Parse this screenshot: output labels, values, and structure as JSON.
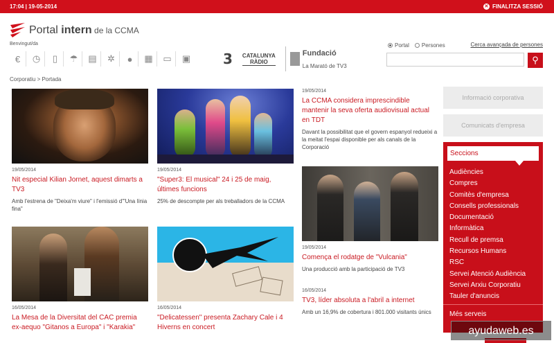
{
  "topbar": {
    "datetime": "17:04 | 19-05-2014",
    "logout_label": "FINALITZA SESSIÓ"
  },
  "header": {
    "brand_prefix": "Portal ",
    "brand_strong": "intern",
    "brand_suffix": " de la CCMA",
    "welcome": "Benvingut/da",
    "icons": [
      "euro-icon",
      "clock-icon",
      "book-icon",
      "umbrella-icon",
      "newspaper-icon",
      "gear-icon",
      "person-icon",
      "calendar-icon",
      "monitor-icon",
      "bus-icon"
    ],
    "channels": {
      "tv3": "3",
      "catradio_1": "CATALUNYA",
      "catradio_2": "RÀDIO",
      "fund_1": "Fundació",
      "fund_2": "La Marató de TV3"
    }
  },
  "search": {
    "options": [
      "Portal",
      "Persones"
    ],
    "selected": "Portal",
    "advanced": "Cerca avançada de persones",
    "value": ""
  },
  "breadcrumb": "Corporatiu > Portada",
  "news": [
    {
      "date": "19/05/2014",
      "title": "Nit especial Kilian Jornet, aquest dimarts a TV3",
      "desc": "Amb l'estrena de \"Deixa'm viure\" i l'emissió d'\"Una línia fina\""
    },
    {
      "date": "19/05/2014",
      "title": "\"Super3: El musical\" 24 i 25 de maig, últimes funcions",
      "desc": "25% de descompte per als treballadors de la CCMA"
    },
    {
      "date": "19/05/2014",
      "title": "La CCMA considera imprescindible mantenir la seva oferta audiovisual actual en TDT",
      "desc": "Davant la possibilitat que el govern espanyol redueixi a la meitat l'espai disponible per als canals de la Corporació"
    },
    {
      "date": "19/05/2014",
      "title": "Comença el rodatge de \"Vulcania\"",
      "desc": "Una producció amb la participació de TV3"
    },
    {
      "date": "16/05/2014",
      "title": "La Mesa de la Diversitat del CAC premia ex-aequo \"Gitanos a Europa\" i \"Karakia\"",
      "desc": ""
    },
    {
      "date": "16/05/2014",
      "title": "\"Delicatessen\" presenta Zachary Cale i 4 Hiverns en concert",
      "desc": ""
    },
    {
      "date": "16/05/2014",
      "title": "TV3, líder absoluta a l'abril a internet",
      "desc": "Amb un 16,9% de cobertura i 801.000 visitants únics"
    }
  ],
  "sidebar": {
    "btn_info": "Informació corporativa",
    "btn_comm": "Comunicats d'empresa",
    "sections_title": "Seccions",
    "sections": [
      "Audiències",
      "Compres",
      "Comitès d'empresa",
      "Consells professionals",
      "Documentació",
      "Informàtica",
      "Recull de premsa",
      "Recursos Humans",
      "RSC",
      "Servei Atenció Audiència",
      "Servei Arxiu Corporatiu",
      "Tauler d'anuncis"
    ],
    "more": "Més serveis"
  },
  "watermark": "ayudaweb.es",
  "colors": {
    "accent": "#c80f1a",
    "title_red": "#c91a22"
  }
}
